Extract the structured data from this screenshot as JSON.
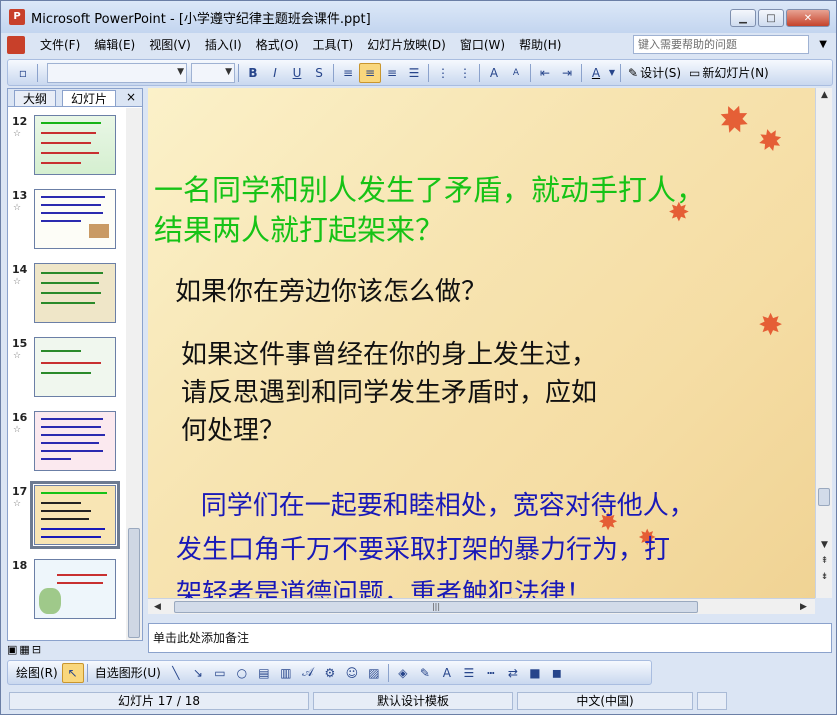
{
  "window": {
    "title": "Microsoft PowerPoint - [小学遵守纪律主题班会课件.ppt]",
    "app_icon": "P",
    "controls": {
      "minimize": "▁",
      "maximize": "□",
      "close": "✕"
    }
  },
  "menu": {
    "items": [
      "文件(F)",
      "编辑(E)",
      "视图(V)",
      "插入(I)",
      "格式(O)",
      "工具(T)",
      "幻灯片放映(D)",
      "窗口(W)",
      "帮助(H)"
    ],
    "help_placeholder": "键入需要帮助的问题"
  },
  "toolbar": {
    "bold": "B",
    "italic": "I",
    "underline": "U",
    "shadow": "S",
    "design_label": "设计(S)",
    "new_slide_label": "新幻灯片(N)"
  },
  "left_panel": {
    "tabs": [
      "大纲",
      "幻灯片"
    ],
    "close": "×",
    "slides": [
      {
        "number": "12",
        "star": "☆"
      },
      {
        "number": "13",
        "star": "☆"
      },
      {
        "number": "14",
        "star": "☆"
      },
      {
        "number": "15",
        "star": "☆"
      },
      {
        "number": "16",
        "star": "☆"
      },
      {
        "number": "17",
        "star": "☆"
      },
      {
        "number": "18",
        "star": ""
      }
    ],
    "selected_index": 5
  },
  "slide": {
    "green_text_line1": "一名同学和别人发生了矛盾，就动手打人，",
    "green_text_line2": "结果两人就打起架来？",
    "question": "如果你在旁边你该怎么做？",
    "reflect_line1": "如果这件事曾经在你的身上发生过，",
    "reflect_line2": "请反思遇到和同学发生矛盾时，应如",
    "reflect_line3": "何处理？",
    "advice_line1": "   同学们在一起要和睦相处，宽容对待他人，",
    "advice_line2": "发生口角千万不要采取打架的暴力行为，打",
    "advice_line3": "架轻者是道德问题，重者触犯法律！"
  },
  "notes_placeholder": "单击此处添加备注",
  "drawing_toolbar": {
    "draw_label": "绘图(R)",
    "autoshape_label": "自选图形(U)"
  },
  "status": {
    "slide_position": "幻灯片 17 / 18",
    "template": "默认设计模板",
    "language": "中文(中国)"
  },
  "colors": {
    "green_text": "#16c316",
    "blue_text": "#1919b8",
    "leaf": "#e4512a"
  }
}
